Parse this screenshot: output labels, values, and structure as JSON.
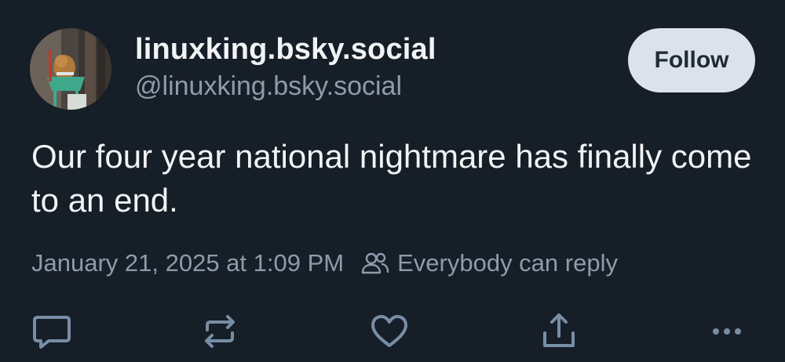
{
  "author": {
    "display_name": "linuxking.bsky.social",
    "handle": "@linuxking.bsky.social",
    "avatar_icon": "avatar-photo-icon"
  },
  "follow_label": "Follow",
  "post": {
    "text": "Our four year national nightmare has finally come to an end.",
    "timestamp": "January 21, 2025 at 1:09 PM",
    "reply_setting": "Everybody can reply"
  },
  "actions": [
    {
      "name": "reply",
      "icon": "comment-icon"
    },
    {
      "name": "repost",
      "icon": "repost-icon"
    },
    {
      "name": "like",
      "icon": "heart-icon"
    },
    {
      "name": "share",
      "icon": "share-icon"
    },
    {
      "name": "more",
      "icon": "more-options-icon"
    }
  ],
  "colors": {
    "background": "#161e27",
    "primary_text": "#f1f3f5",
    "secondary_text": "#8d9bab",
    "follow_button_bg": "#dce2ea",
    "follow_button_text": "#1e2a36",
    "icon": "#788ea5"
  }
}
